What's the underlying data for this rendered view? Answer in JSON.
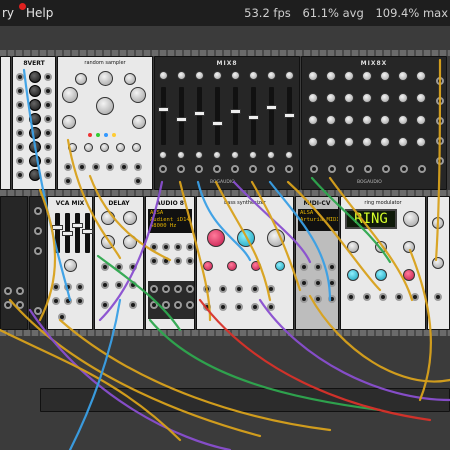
{
  "menu": {
    "library_label": "ry",
    "help_label": "Help",
    "help_dot_color": "#e0211f"
  },
  "perf": {
    "fps": "53.2 fps",
    "avg": "61.1% avg",
    "max": "109.4% max"
  },
  "modules": {
    "eight_vert": {
      "title": "8VERT"
    },
    "sampler": {
      "title": "random sampler"
    },
    "mix8": {
      "title": "MIX8",
      "brand": "BOGAUDIO"
    },
    "mix8x": {
      "title": "MIX8X",
      "brand": "BOGAUDIO"
    },
    "vca_mix": {
      "title": "VCA MIX"
    },
    "delay": {
      "title": "DELAY"
    },
    "audio8": {
      "title": "AUDIO 8",
      "display_line1": "ALSA",
      "display_line2": "Audient iD14 Analog",
      "display_line3": "48000 Hz"
    },
    "synth": {
      "title": "bass synthesizer"
    },
    "midi_cv": {
      "title": "MIDI-CV",
      "display_line1": "ALSA",
      "display_line2": "Arturia MIDI"
    },
    "ring": {
      "title": "ring modulator",
      "lcd_text": "RING"
    }
  },
  "colors": {
    "cable_yellow": "#d9a21c",
    "cable_purple": "#8a4fd0",
    "cable_blue": "#3aa0e6",
    "cable_green": "#2fa84f",
    "cable_red": "#d8322a"
  }
}
